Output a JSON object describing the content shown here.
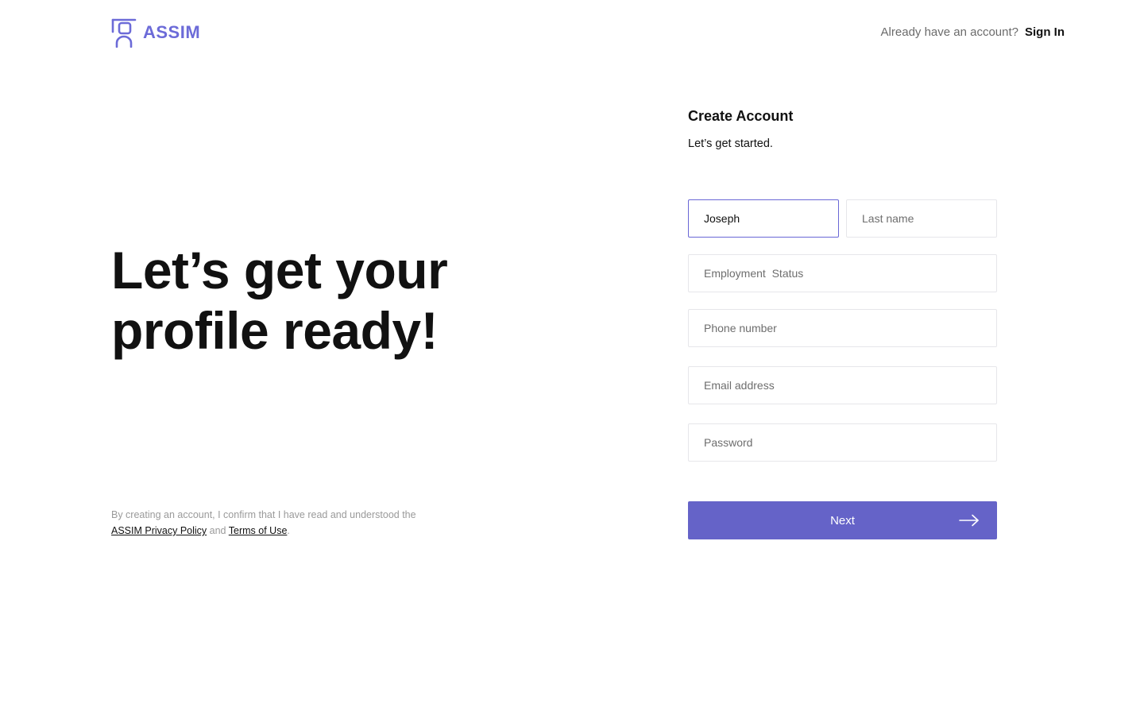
{
  "brand": {
    "name": "ASSIM",
    "icon": "assim-logo-icon",
    "color": "#6c6bd8"
  },
  "header": {
    "signin_prompt": "Already have an account?",
    "signin_label": "Sign In"
  },
  "hero": {
    "line1": "Let’s get your",
    "line2": "profile ready!"
  },
  "legal": {
    "prefix": "By creating an account, I confirm that I have read and understood the",
    "privacy_label": "ASSIM Privacy Policy",
    "and": "and",
    "terms_label": "Terms of Use",
    "suffix": "."
  },
  "form": {
    "title": "Create Account",
    "subtitle": "Let’s get started.",
    "fields": {
      "first_name": {
        "value": "Joseph",
        "placeholder": ""
      },
      "last_name": {
        "value": "",
        "placeholder": "Last name"
      },
      "employment_status": {
        "value": "",
        "placeholder": "Employment  Status"
      },
      "phone": {
        "value": "",
        "placeholder": "Phone number"
      },
      "email": {
        "value": "",
        "placeholder": "Email address"
      },
      "password": {
        "value": "",
        "placeholder": "Password"
      }
    },
    "next_label": "Next",
    "next_icon": "arrow-right-icon",
    "accent_color": "#6563c8"
  }
}
